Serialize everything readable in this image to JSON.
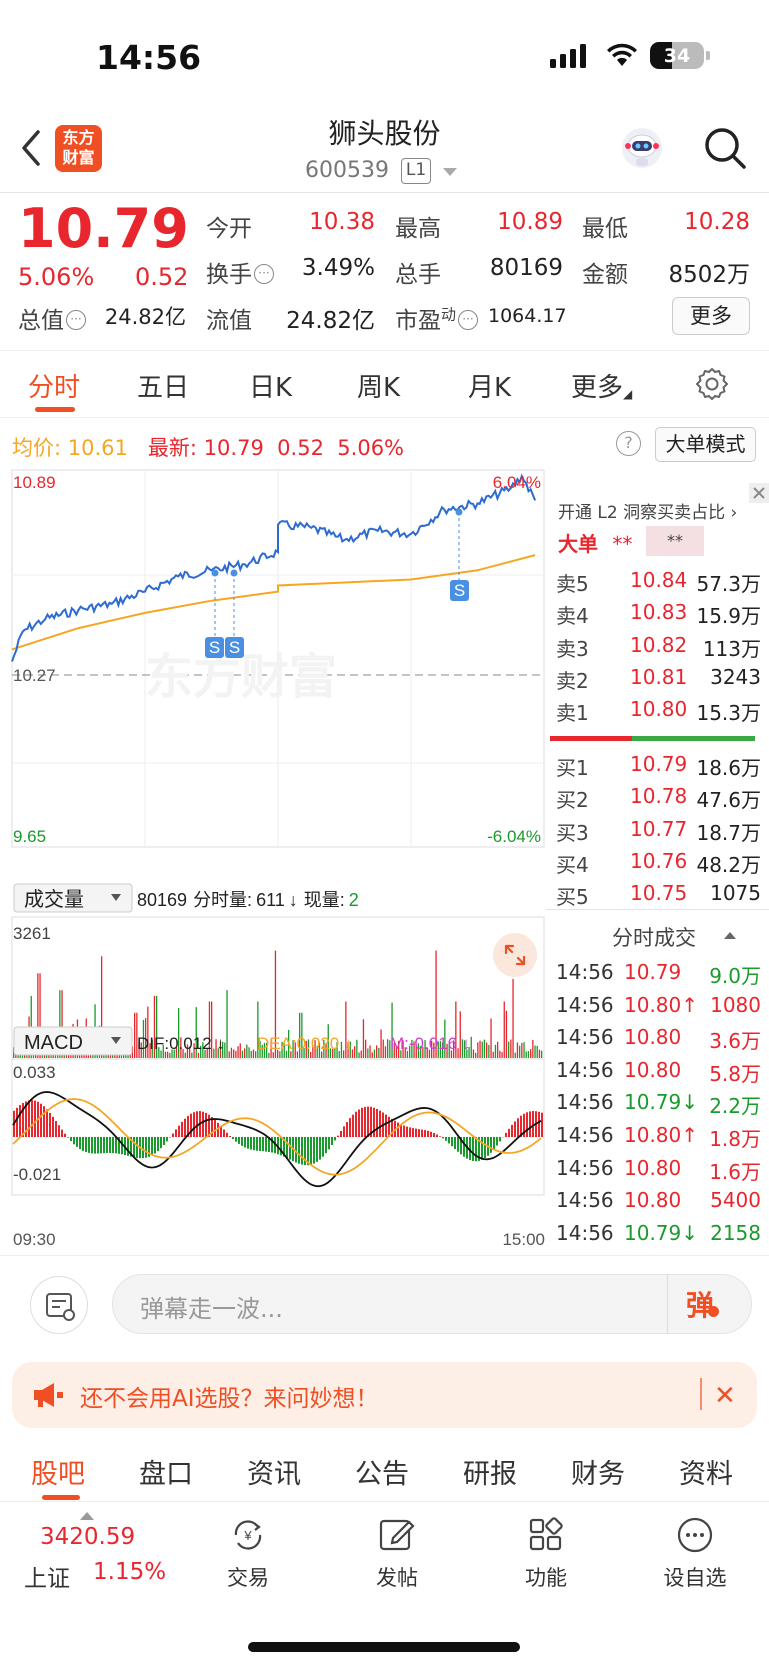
{
  "status_bar": {
    "time": "14:56",
    "battery": "34"
  },
  "header": {
    "logo_line1": "东方",
    "logo_line2": "财富",
    "stock_name": "狮头股份",
    "stock_code": "600539",
    "level_badge": "L1"
  },
  "quote": {
    "price": "10.79",
    "change_pct": "5.06%",
    "change_amt": "0.52",
    "open_label": "今开",
    "open": "10.38",
    "high_label": "最高",
    "high": "10.89",
    "low_label": "最低",
    "low": "10.28",
    "turnover_label": "换手",
    "turnover": "3.49%",
    "volume_label": "总手",
    "volume": "80169",
    "amount_label": "金额",
    "amount": "8502万",
    "total_cap_label": "总值",
    "total_cap": "24.82亿",
    "float_cap_label": "流值",
    "float_cap": "24.82亿",
    "pe_label": "市盈",
    "pe_sup": "动",
    "pe": "1064.17",
    "more_button": "更多"
  },
  "chart_tabs": [
    "分时",
    "五日",
    "日K",
    "周K",
    "月K",
    "更多"
  ],
  "avg_row": {
    "avg_label": "均价:",
    "avg": "10.61",
    "latest_label": "最新:",
    "latest": "10.79",
    "latest_chg": "0.52",
    "latest_pct": "5.06%"
  },
  "help_icon": "?",
  "big_order_mode": "大单模式",
  "chart_labels": {
    "price_high": "10.89",
    "pct_high": "6.04%",
    "prev_close": "10.27",
    "price_low": "9.65",
    "pct_low": "-6.04%",
    "watermark": "东方财富",
    "vol_selector": "成交量",
    "vol_total": "80169",
    "vol_minute_label": "分时量:",
    "vol_minute": "611",
    "vol_now_label": "现量:",
    "vol_now": "2",
    "vol_max": "3261",
    "macd_selector": "MACD",
    "dif": "DIF:0.012",
    "dea": "DEA:0.020",
    "m": "M:-0.016",
    "macd_max": "0.033",
    "macd_min": "-0.021",
    "time_start": "09:30",
    "time_end": "15:00",
    "sell_marker": "S"
  },
  "order_panel": {
    "l2_text": "开通 L2 洞察买卖占比",
    "big_order_label": "大单",
    "big_order_red": "**",
    "big_order_mask": "**",
    "asks": [
      {
        "label": "卖5",
        "price": "10.84",
        "vol": "57.3万"
      },
      {
        "label": "卖4",
        "price": "10.83",
        "vol": "15.9万"
      },
      {
        "label": "卖3",
        "price": "10.82",
        "vol": "113万"
      },
      {
        "label": "卖2",
        "price": "10.81",
        "vol": "3243"
      },
      {
        "label": "卖1",
        "price": "10.80",
        "vol": "15.3万"
      }
    ],
    "bids": [
      {
        "label": "买1",
        "price": "10.79",
        "vol": "18.6万"
      },
      {
        "label": "买2",
        "price": "10.78",
        "vol": "47.6万"
      },
      {
        "label": "买3",
        "price": "10.77",
        "vol": "18.7万"
      },
      {
        "label": "买4",
        "price": "10.76",
        "vol": "48.2万"
      },
      {
        "label": "买5",
        "price": "10.75",
        "vol": "1075"
      }
    ],
    "trades_title": "分时成交",
    "trades": [
      {
        "time": "14:56",
        "price": "10.79",
        "dir": "",
        "vol": "9.0万",
        "color": "#1a9a2c"
      },
      {
        "time": "14:56",
        "price": "10.80↑",
        "dir": "up",
        "vol": "1080",
        "color": "#e8262d"
      },
      {
        "time": "14:56",
        "price": "10.80",
        "dir": "",
        "vol": "3.6万",
        "color": "#e8262d"
      },
      {
        "time": "14:56",
        "price": "10.80",
        "dir": "",
        "vol": "5.8万",
        "color": "#e8262d"
      },
      {
        "time": "14:56",
        "price": "10.79↓",
        "dir": "down",
        "vol": "2.2万",
        "color": "#1a9a2c"
      },
      {
        "time": "14:56",
        "price": "10.80↑",
        "dir": "up",
        "vol": "1.8万",
        "color": "#e8262d"
      },
      {
        "time": "14:56",
        "price": "10.80",
        "dir": "",
        "vol": "1.6万",
        "color": "#e8262d"
      },
      {
        "time": "14:56",
        "price": "10.80",
        "dir": "",
        "vol": "5400",
        "color": "#e8262d"
      },
      {
        "time": "14:56",
        "price": "10.79↓",
        "dir": "down",
        "vol": "2158",
        "color": "#1a9a2c"
      }
    ]
  },
  "comment_bar": {
    "placeholder": "弹幕走一波...",
    "danmu_btn": "弹"
  },
  "promo": {
    "text": "还不会用AI选股？来问妙想！",
    "close": "✕"
  },
  "bottom_tabs": [
    "股吧",
    "盘口",
    "资讯",
    "公告",
    "研报",
    "财务",
    "资料"
  ],
  "footer": {
    "index_value": "3420.59",
    "index_name": "上证",
    "index_pct": "1.15%",
    "buttons": [
      "交易",
      "发帖",
      "功能",
      "设自选"
    ]
  },
  "colors": {
    "up": "#e8262d",
    "down": "#1a9a2c",
    "accent": "#f04e23",
    "price_line": "#2e6bd1",
    "avg_line": "#f5a623"
  },
  "chart_data": {
    "type": "line",
    "title": "",
    "x_range": [
      "09:30",
      "15:00"
    ],
    "ylim": [
      9.65,
      10.89
    ],
    "prev_close": 10.27,
    "series": [
      {
        "x": [
          "09:30",
          "09:35",
          "09:45",
          "10:00",
          "10:15",
          "10:30",
          "10:45",
          "11:00",
          "11:15",
          "11:30",
          "13:00",
          "13:15",
          "13:30",
          "13:45",
          "14:00",
          "14:15",
          "14:30",
          "14:45",
          "14:50",
          "14:56"
        ],
        "values": [
          10.26,
          10.36,
          10.4,
          10.43,
          10.45,
          10.49,
          10.54,
          10.56,
          10.58,
          10.62,
          10.71,
          10.7,
          10.66,
          10.69,
          10.68,
          10.76,
          10.78,
          10.83,
          10.87,
          10.79
        ]
      },
      {
        "x": [
          "09:30",
          "10:00",
          "10:30",
          "11:00",
          "11:30",
          "13:00",
          "13:30",
          "14:00",
          "14:30",
          "14:56"
        ],
        "values": [
          10.3,
          10.37,
          10.42,
          10.46,
          10.49,
          10.51,
          10.52,
          10.53,
          10.56,
          10.61
        ]
      }
    ]
  }
}
